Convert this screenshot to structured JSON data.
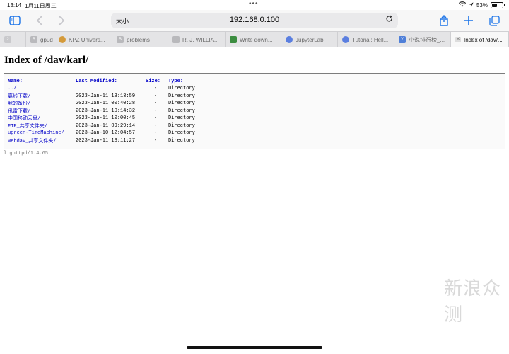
{
  "status": {
    "time": "13:14",
    "date": "1月11日周三",
    "battery": "53%",
    "battery_level": 0.53
  },
  "toolbar": {
    "aa_label": "大小",
    "url": "192.168.0.100"
  },
  "tabs": [
    {
      "label": "",
      "icon": "placeholder",
      "color": "#9aa0a6"
    },
    {
      "label": "gpud",
      "icon": "placeholder",
      "color": "#9aa0a6"
    },
    {
      "label": "KPZ Univers...",
      "icon": "avatar",
      "color": "#d49a3a"
    },
    {
      "label": "problems",
      "icon": "placeholder",
      "color": "#9aa0a6"
    },
    {
      "label": "R. J. WILLIA...",
      "icon": "placeholder",
      "color": "#9aa0a6"
    },
    {
      "label": "Write down...",
      "icon": "document",
      "color": "#3c8d40"
    },
    {
      "label": "JupyterLab",
      "icon": "globe",
      "color": "#5b7fe0"
    },
    {
      "label": "Tutorial: Hell...",
      "icon": "globe",
      "color": "#5b7fe0"
    },
    {
      "label": "小说排行榜_...",
      "icon": "book",
      "color": "#4f7fd8"
    },
    {
      "label": "Index of /dav/...",
      "icon": "close",
      "color": "#777777"
    }
  ],
  "page": {
    "title": "Index of /dav/karl/",
    "headers": {
      "name": "Name:",
      "modified": "Last Modified:",
      "size": "Size:",
      "type": "Type:"
    },
    "rows": [
      {
        "name": "../",
        "modified": "",
        "size": "-",
        "type": "Directory"
      },
      {
        "name": "离线下载/",
        "modified": "2023-Jan-11 13:13:59",
        "size": "-",
        "type": "Directory"
      },
      {
        "name": "我的备份/",
        "modified": "2023-Jan-11 00:40:28",
        "size": "-",
        "type": "Directory"
      },
      {
        "name": "迅雷下载/",
        "modified": "2023-Jan-11 10:14:32",
        "size": "-",
        "type": "Directory"
      },
      {
        "name": "中国移动云盘/",
        "modified": "2023-Jan-11 10:00:45",
        "size": "-",
        "type": "Directory"
      },
      {
        "name": "FTP_共享文件夹/",
        "modified": "2023-Jan-11 09:29:14",
        "size": "-",
        "type": "Directory"
      },
      {
        "name": "ugreen-TimeMachine/",
        "modified": "2023-Jan-10 12:04:57",
        "size": "-",
        "type": "Directory"
      },
      {
        "name": "Webdav_共享文件夹/",
        "modified": "2023-Jan-11 13:11:27",
        "size": "-",
        "type": "Directory"
      }
    ],
    "footer": "lighttpd/1.4.65"
  },
  "watermark": "新浪众测"
}
